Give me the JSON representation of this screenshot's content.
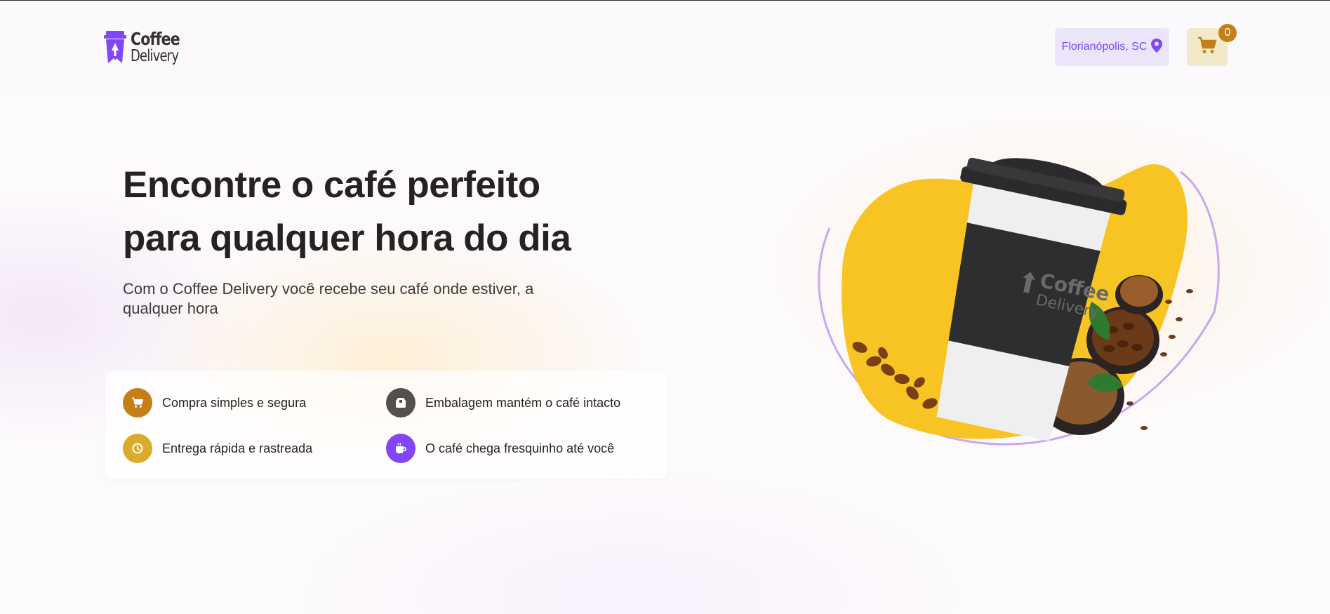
{
  "header": {
    "logo": {
      "line1": "Coffee",
      "line2": "Delivery",
      "icon": "coffee-cup-logo-icon"
    },
    "location": {
      "label": "Florianópolis, SC",
      "icon": "map-pin-icon"
    },
    "cart": {
      "icon": "shopping-cart-icon",
      "count": "0"
    }
  },
  "hero": {
    "title_line1": "Encontre o café perfeito",
    "title_line2": "para qualquer hora do dia",
    "subtitle_line1": "Com o Coffee Delivery você recebe seu café onde estiver, a",
    "subtitle_line2": "qualquer hora",
    "image": {
      "cup_brand_line1": "Coffee",
      "cup_brand_line2": "Delivery"
    }
  },
  "features": [
    {
      "label": "Compra simples e segura",
      "icon": "shopping-cart-icon",
      "color": "#c47f17"
    },
    {
      "label": "Embalagem mantém o café intacto",
      "icon": "package-icon",
      "color": "#574f4d"
    },
    {
      "label": "Entrega rápida e rastreada",
      "icon": "clock-icon",
      "color": "#dbac2c"
    },
    {
      "label": "O café chega fresquinho até você",
      "icon": "coffee-icon",
      "color": "#8047f8"
    }
  ],
  "colors": {
    "brand_purple": "#8047f8",
    "purple_light": "#ebe5f9",
    "yellow_dark": "#c47f17",
    "yellow": "#dbac2c",
    "yellow_light": "#f1e9c9",
    "text_title": "#272221"
  }
}
